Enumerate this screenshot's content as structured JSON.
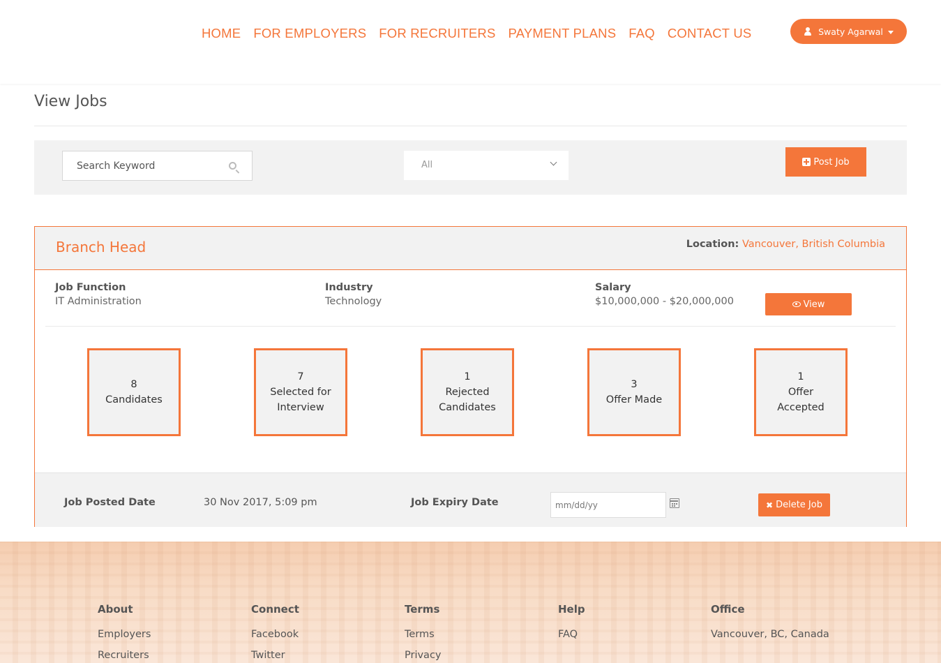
{
  "nav": {
    "items": [
      "HOME",
      "FOR EMPLOYERS",
      "FOR RECRUITERS",
      "PAYMENT PLANS",
      "FAQ",
      "CONTACT US"
    ]
  },
  "user": {
    "name": "Swaty Agarwal"
  },
  "page": {
    "title": "View Jobs"
  },
  "filters": {
    "search_placeholder": "Search Keyword",
    "select_value": "All",
    "post_label": "Post Job"
  },
  "job": {
    "title": "Branch Head",
    "location_label": "Location:",
    "location_value": "Vancouver, British Columbia",
    "function_label": "Job Function",
    "function_value": "IT Administration",
    "industry_label": "Industry",
    "industry_value": "Technology",
    "salary_label": "Salary",
    "salary_value": "$10,000,000 - $20,000,000",
    "view_label": "View",
    "stats": [
      {
        "count": "8",
        "label": "Candidates"
      },
      {
        "count": "7",
        "label": "Selected for Interview"
      },
      {
        "count": "1",
        "label": "Rejected Candidates"
      },
      {
        "count": "3",
        "label": "Offer Made"
      },
      {
        "count": "1",
        "label": "Offer Accepted"
      }
    ],
    "posted_label": "Job Posted Date",
    "posted_value": "30 Nov 2017, 5:09 pm",
    "expiry_label": "Job Expiry Date",
    "expiry_placeholder": "mm/dd/yy",
    "delete_label": "Delete Job"
  },
  "footer": {
    "columns": [
      {
        "heading": "About",
        "links": [
          "Employers",
          "Recruiters"
        ]
      },
      {
        "heading": "Connect",
        "links": [
          "Facebook",
          "Twitter"
        ]
      },
      {
        "heading": "Terms",
        "links": [
          "Terms",
          "Privacy"
        ]
      },
      {
        "heading": "Help",
        "links": [
          "FAQ"
        ]
      },
      {
        "heading": "Office",
        "links": [
          "Vancouver, BC, Canada"
        ]
      }
    ]
  },
  "colors": {
    "accent": "#f4763a",
    "panel": "#f2f2f2"
  }
}
